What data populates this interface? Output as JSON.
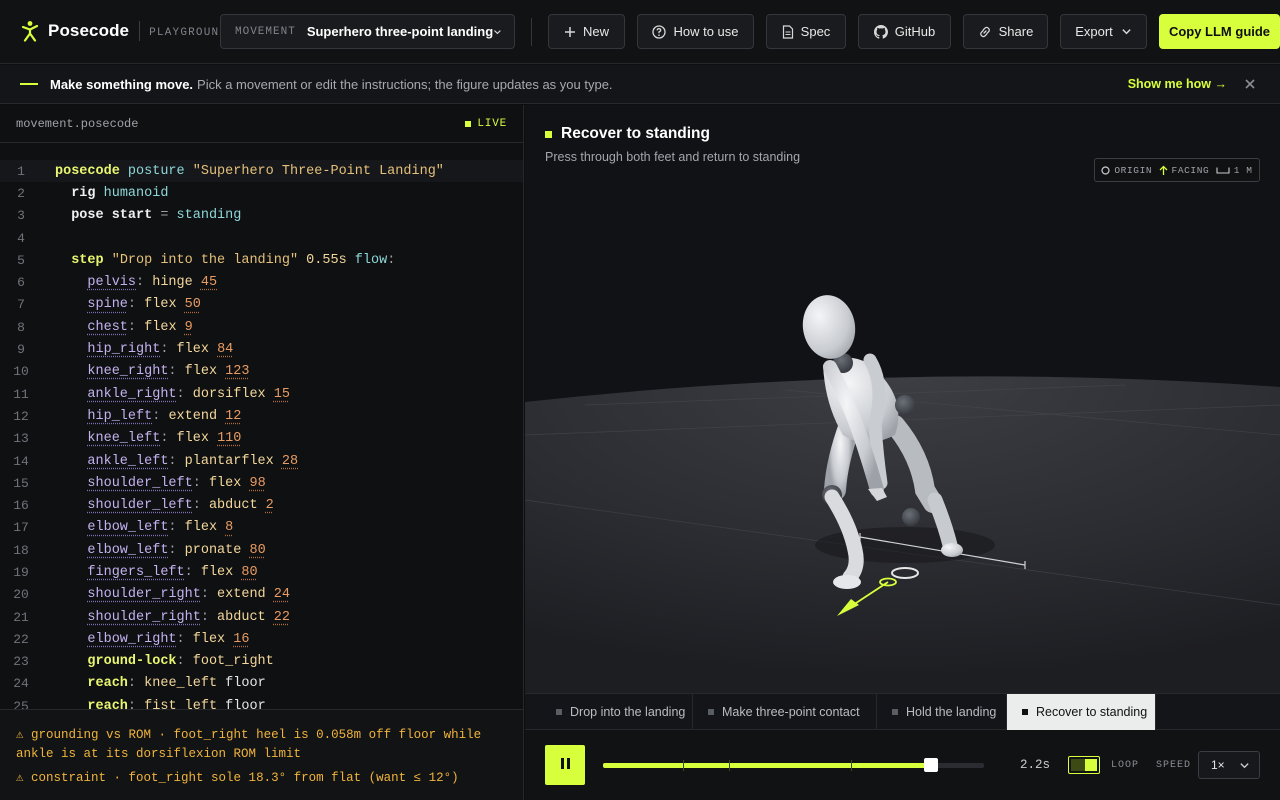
{
  "app": {
    "name": "Posecode",
    "subtitle": "PLAYGROUND"
  },
  "movement": {
    "label": "MOVEMENT",
    "value": "Superhero three-point landing"
  },
  "toolbar": {
    "new": "New",
    "how_to_use": "How to use",
    "spec": "Spec",
    "github": "GitHub",
    "share": "Share",
    "export": "Export",
    "copy_guide": "Copy LLM guide"
  },
  "banner": {
    "strong": "Make something move.",
    "message": "Pick a movement or edit the instructions; the figure updates as you type.",
    "action": "Show me how →"
  },
  "editor": {
    "filename": "movement.posecode",
    "status": "LIVE",
    "lines": [
      {
        "n": "1",
        "tokens": [
          [
            "kw",
            "posecode"
          ],
          [
            "plain",
            " "
          ],
          [
            "id",
            "posture"
          ],
          [
            "plain",
            " "
          ],
          [
            "str",
            "\"Superhero Three-Point Landing\""
          ]
        ]
      },
      {
        "n": "2",
        "tokens": [
          [
            "plain",
            "  "
          ],
          [
            "kw2",
            "rig"
          ],
          [
            "plain",
            " "
          ],
          [
            "id",
            "humanoid"
          ]
        ]
      },
      {
        "n": "3",
        "tokens": [
          [
            "plain",
            "  "
          ],
          [
            "kw2",
            "pose start"
          ],
          [
            "plain",
            " "
          ],
          [
            "punc",
            "="
          ],
          [
            "plain",
            " "
          ],
          [
            "id",
            "standing"
          ]
        ]
      },
      {
        "n": "4",
        "tokens": []
      },
      {
        "n": "5",
        "tokens": [
          [
            "plain",
            "  "
          ],
          [
            "kw",
            "step"
          ],
          [
            "plain",
            " "
          ],
          [
            "str",
            "\"Drop into the landing\""
          ],
          [
            "plain",
            " "
          ],
          [
            "action",
            "0.55s"
          ],
          [
            "plain",
            " "
          ],
          [
            "id",
            "flow"
          ],
          [
            "punc",
            ":"
          ]
        ]
      },
      {
        "n": "6",
        "tokens": [
          [
            "plain",
            "    "
          ],
          [
            "joint",
            "pelvis"
          ],
          [
            "punc",
            ":"
          ],
          [
            "plain",
            " "
          ],
          [
            "action",
            "hinge"
          ],
          [
            "plain",
            " "
          ],
          [
            "num",
            "45"
          ]
        ]
      },
      {
        "n": "7",
        "tokens": [
          [
            "plain",
            "    "
          ],
          [
            "joint",
            "spine"
          ],
          [
            "punc",
            ":"
          ],
          [
            "plain",
            " "
          ],
          [
            "action",
            "flex"
          ],
          [
            "plain",
            " "
          ],
          [
            "num",
            "50"
          ]
        ]
      },
      {
        "n": "8",
        "tokens": [
          [
            "plain",
            "    "
          ],
          [
            "joint",
            "chest"
          ],
          [
            "punc",
            ":"
          ],
          [
            "plain",
            " "
          ],
          [
            "action",
            "flex"
          ],
          [
            "plain",
            " "
          ],
          [
            "num",
            "9"
          ]
        ]
      },
      {
        "n": "9",
        "tokens": [
          [
            "plain",
            "    "
          ],
          [
            "joint",
            "hip_right"
          ],
          [
            "punc",
            ":"
          ],
          [
            "plain",
            " "
          ],
          [
            "action",
            "flex"
          ],
          [
            "plain",
            " "
          ],
          [
            "num",
            "84"
          ]
        ]
      },
      {
        "n": "10",
        "tokens": [
          [
            "plain",
            "    "
          ],
          [
            "joint",
            "knee_right"
          ],
          [
            "punc",
            ":"
          ],
          [
            "plain",
            " "
          ],
          [
            "action",
            "flex"
          ],
          [
            "plain",
            " "
          ],
          [
            "num",
            "123"
          ]
        ]
      },
      {
        "n": "11",
        "tokens": [
          [
            "plain",
            "    "
          ],
          [
            "joint",
            "ankle_right"
          ],
          [
            "punc",
            ":"
          ],
          [
            "plain",
            " "
          ],
          [
            "action",
            "dorsiflex"
          ],
          [
            "plain",
            " "
          ],
          [
            "num",
            "15"
          ]
        ]
      },
      {
        "n": "12",
        "tokens": [
          [
            "plain",
            "    "
          ],
          [
            "joint",
            "hip_left"
          ],
          [
            "punc",
            ":"
          ],
          [
            "plain",
            " "
          ],
          [
            "action",
            "extend"
          ],
          [
            "plain",
            " "
          ],
          [
            "num",
            "12"
          ]
        ]
      },
      {
        "n": "13",
        "tokens": [
          [
            "plain",
            "    "
          ],
          [
            "joint",
            "knee_left"
          ],
          [
            "punc",
            ":"
          ],
          [
            "plain",
            " "
          ],
          [
            "action",
            "flex"
          ],
          [
            "plain",
            " "
          ],
          [
            "num",
            "110"
          ]
        ]
      },
      {
        "n": "14",
        "tokens": [
          [
            "plain",
            "    "
          ],
          [
            "joint",
            "ankle_left"
          ],
          [
            "punc",
            ":"
          ],
          [
            "plain",
            " "
          ],
          [
            "action",
            "plantarflex"
          ],
          [
            "plain",
            " "
          ],
          [
            "num",
            "28"
          ]
        ]
      },
      {
        "n": "15",
        "tokens": [
          [
            "plain",
            "    "
          ],
          [
            "joint",
            "shoulder_left"
          ],
          [
            "punc",
            ":"
          ],
          [
            "plain",
            " "
          ],
          [
            "action",
            "flex"
          ],
          [
            "plain",
            " "
          ],
          [
            "num",
            "98"
          ]
        ]
      },
      {
        "n": "16",
        "tokens": [
          [
            "plain",
            "    "
          ],
          [
            "joint",
            "shoulder_left"
          ],
          [
            "punc",
            ":"
          ],
          [
            "plain",
            " "
          ],
          [
            "action",
            "abduct"
          ],
          [
            "plain",
            " "
          ],
          [
            "num",
            "2"
          ]
        ]
      },
      {
        "n": "17",
        "tokens": [
          [
            "plain",
            "    "
          ],
          [
            "joint",
            "elbow_left"
          ],
          [
            "punc",
            ":"
          ],
          [
            "plain",
            " "
          ],
          [
            "action",
            "flex"
          ],
          [
            "plain",
            " "
          ],
          [
            "num",
            "8"
          ]
        ]
      },
      {
        "n": "18",
        "tokens": [
          [
            "plain",
            "    "
          ],
          [
            "joint",
            "elbow_left"
          ],
          [
            "punc",
            ":"
          ],
          [
            "plain",
            " "
          ],
          [
            "action",
            "pronate"
          ],
          [
            "plain",
            " "
          ],
          [
            "num",
            "80"
          ]
        ]
      },
      {
        "n": "19",
        "tokens": [
          [
            "plain",
            "    "
          ],
          [
            "joint",
            "fingers_left"
          ],
          [
            "punc",
            ":"
          ],
          [
            "plain",
            " "
          ],
          [
            "action",
            "flex"
          ],
          [
            "plain",
            " "
          ],
          [
            "num",
            "80"
          ]
        ]
      },
      {
        "n": "20",
        "tokens": [
          [
            "plain",
            "    "
          ],
          [
            "joint",
            "shoulder_right"
          ],
          [
            "punc",
            ":"
          ],
          [
            "plain",
            " "
          ],
          [
            "action",
            "extend"
          ],
          [
            "plain",
            " "
          ],
          [
            "num",
            "24"
          ]
        ]
      },
      {
        "n": "21",
        "tokens": [
          [
            "plain",
            "    "
          ],
          [
            "joint",
            "shoulder_right"
          ],
          [
            "punc",
            ":"
          ],
          [
            "plain",
            " "
          ],
          [
            "action",
            "abduct"
          ],
          [
            "plain",
            " "
          ],
          [
            "num",
            "22"
          ]
        ]
      },
      {
        "n": "22",
        "tokens": [
          [
            "plain",
            "    "
          ],
          [
            "joint",
            "elbow_right"
          ],
          [
            "punc",
            ":"
          ],
          [
            "plain",
            " "
          ],
          [
            "action",
            "flex"
          ],
          [
            "plain",
            " "
          ],
          [
            "num",
            "16"
          ]
        ]
      },
      {
        "n": "23",
        "tokens": [
          [
            "plain",
            "    "
          ],
          [
            "kw",
            "ground-lock"
          ],
          [
            "punc",
            ":"
          ],
          [
            "plain",
            " "
          ],
          [
            "joint2",
            "foot_right"
          ]
        ]
      },
      {
        "n": "24",
        "tokens": [
          [
            "plain",
            "    "
          ],
          [
            "kw",
            "reach"
          ],
          [
            "punc",
            ":"
          ],
          [
            "plain",
            " "
          ],
          [
            "joint2",
            "knee_left"
          ],
          [
            "plain",
            " "
          ],
          [
            "plain",
            "floor"
          ]
        ]
      },
      {
        "n": "25",
        "tokens": [
          [
            "plain",
            "    "
          ],
          [
            "kw",
            "reach"
          ],
          [
            "punc",
            ":"
          ],
          [
            "plain",
            " "
          ],
          [
            "joint2",
            "fist_left"
          ],
          [
            "plain",
            " "
          ],
          [
            "plain",
            "floor"
          ]
        ]
      }
    ]
  },
  "warnings": [
    "⚠ grounding vs ROM · foot_right heel is 0.058m off floor while ankle is at its dorsiflexion ROM limit",
    "⚠ constraint · foot_right sole 18.3° from flat (want ≤ 12°)"
  ],
  "viewport": {
    "title": "Recover to standing",
    "subtitle": "Press through both feet and return to standing",
    "legend": {
      "origin": "ORIGIN",
      "facing": "FACING",
      "scale": "1 M"
    }
  },
  "steps": [
    {
      "label": "Drop into the landing",
      "active": false
    },
    {
      "label": "Make three-point contact",
      "active": false
    },
    {
      "label": "Hold the landing",
      "active": false
    },
    {
      "label": "Recover to standing",
      "active": true
    }
  ],
  "player": {
    "time": "2.2s",
    "progress": 0.86,
    "step_markers": [
      0.21,
      0.33,
      0.65
    ],
    "loop_label": "LOOP",
    "loop_on": true,
    "speed_label": "SPEED",
    "speed": "1×"
  },
  "colors": {
    "accent": "#d8ff3c",
    "warning": "#f0b43c"
  }
}
